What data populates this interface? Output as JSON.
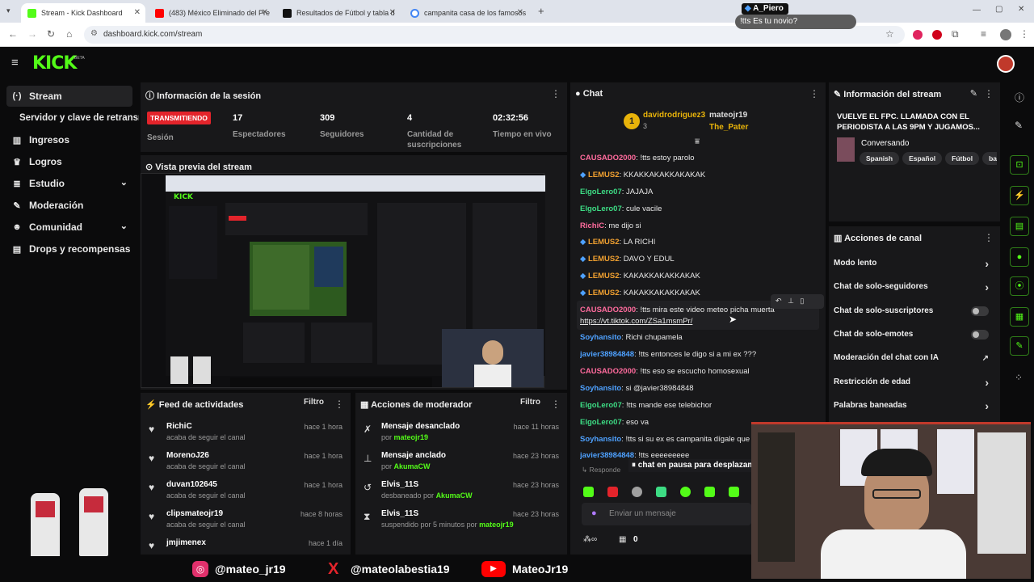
{
  "browser": {
    "tabs": [
      {
        "label": "Stream - Kick Dashboard",
        "color": "#53fc18"
      },
      {
        "label": "(483) México Eliminado del Pre",
        "color": "#ff0000"
      },
      {
        "label": "Resultados de Fútbol y tabla d",
        "color": "#111111"
      },
      {
        "label": "campanita casa de los famosos",
        "color": "#4285f4"
      }
    ],
    "url": "dashboard.kick.com/stream",
    "overlay_user": "A_Piero",
    "overlay_msg": "!tts Es tu novio?"
  },
  "app": {
    "logo": "KICK",
    "logo_badge": "BETA"
  },
  "sidebar": {
    "items": [
      {
        "label": "Stream",
        "icon": "radio-icon"
      },
      {
        "label": "Servidor y clave de retransm"
      },
      {
        "label": "Ingresos",
        "icon": "chart-icon"
      },
      {
        "label": "Logros",
        "icon": "trophy-icon"
      },
      {
        "label": "Estudio",
        "icon": "layers-icon"
      },
      {
        "label": "Moderación",
        "icon": "wrench-icon"
      },
      {
        "label": "Comunidad",
        "icon": "people-icon"
      },
      {
        "label": "Drops y recompensas",
        "icon": "gift-icon"
      }
    ]
  },
  "session": {
    "title": "Información de la sesión",
    "live_badge": "TRANSMITIENDO",
    "session_label": "Sesión",
    "viewers": "17",
    "viewers_label": "Espectadores",
    "followers": "309",
    "followers_label": "Seguidores",
    "subs": "4",
    "subs_label_1": "Cantidad de",
    "subs_label_2": "suscripciones",
    "uptime": "02:32:56",
    "uptime_label": "Tiempo en vivo"
  },
  "preview": {
    "title": "Vista previa del stream"
  },
  "feed": {
    "title": "Feed de actividades",
    "filter": "Filtro",
    "rows": [
      {
        "name": "RichiC",
        "sub": "acaba de seguir el canal",
        "time": "hace 1 hora"
      },
      {
        "name": "MorenoJ26",
        "sub": "acaba de seguir el canal",
        "time": "hace 1 hora"
      },
      {
        "name": "duvan102645",
        "sub": "acaba de seguir el canal",
        "time": "hace 1 hora"
      },
      {
        "name": "clipsmateojr19",
        "sub": "acaba de seguir el canal",
        "time": "hace 8 horas"
      },
      {
        "name": "jmjimenex",
        "sub": "",
        "time": "hace 1 día"
      }
    ]
  },
  "modactions": {
    "title": "Acciones de moderador",
    "filter": "Filtro",
    "rows": [
      {
        "name": "Mensaje desanclado",
        "pre": "por ",
        "who": "mateojr19",
        "time": "hace 11 horas"
      },
      {
        "name": "Mensaje anclado",
        "pre": "por ",
        "who": "AkumaCW",
        "time": "hace 23 horas"
      },
      {
        "name": "Elvis_11S",
        "pre": "desbaneado por ",
        "who": "AkumaCW",
        "time": "hace 23 horas"
      },
      {
        "name": "Elvis_11S",
        "pre": "suspendido por 5 minutos por ",
        "who": "mateojr19",
        "time": "hace 23 horas"
      }
    ]
  },
  "chat": {
    "title": "Chat",
    "top1": "davidrodriguez3",
    "top1_count": "3",
    "top2": "mateojr19",
    "top3": "The_Pater",
    "pause": "chat en pausa para desplazam",
    "reply": "Responde",
    "input_placeholder": "Enviar un mensaje",
    "points": "0",
    "messages": [
      {
        "user": "CAUSADO2000",
        "color": "#ff6b9d",
        "text": ": !tts estoy parolo"
      },
      {
        "user": "LEMUS2",
        "color": "#f0a030",
        "text": ": KKAKKAKAKKAKAKAK"
      },
      {
        "user": "ElgoLero07",
        "color": "#3ddc84",
        "text": ": JAJAJA"
      },
      {
        "user": "ElgoLero07",
        "color": "#3ddc84",
        "text": ": cule vacile"
      },
      {
        "user": "RichiC",
        "color": "#ff6b9d",
        "text": ": me dijo si"
      },
      {
        "user": "LEMUS2",
        "color": "#f0a030",
        "text": ": LA RICHI"
      },
      {
        "user": "LEMUS2",
        "color": "#f0a030",
        "text": ": DAVO Y EDUL"
      },
      {
        "user": "LEMUS2",
        "color": "#f0a030",
        "text": ": KAKAKKAKAKKAKAK"
      },
      {
        "user": "LEMUS2",
        "color": "#f0a030",
        "text": ": KAKAKKAKAKKAKAK"
      },
      {
        "user": "CAUSADO2000",
        "color": "#ff6b9d",
        "text": ": !tts mira este video meteo picha muerta"
      },
      {
        "user": "",
        "color": "#ffffff",
        "text": "https://vt.tiktok.com/ZSa1msmPr/"
      },
      {
        "user": "Soyhansito",
        "color": "#4ea1ff",
        "text": ": Richi chupamela"
      },
      {
        "user": "javier38984848",
        "color": "#4ea1ff",
        "text": ": !tts entonces le digo si a mi ex ???"
      },
      {
        "user": "CAUSADO2000",
        "color": "#ff6b9d",
        "text": ": !tts eso se escucho homosexual"
      },
      {
        "user": "Soyhansito",
        "color": "#4ea1ff",
        "text": ": si @javier38984848"
      },
      {
        "user": "ElgoLero07",
        "color": "#3ddc84",
        "text": ": !tts mande ese telebichor"
      },
      {
        "user": "ElgoLero07",
        "color": "#3ddc84",
        "text": ": eso va"
      },
      {
        "user": "Soyhansito",
        "color": "#4ea1ff",
        "text": ": !tts si su ex es campanita dígale que si"
      },
      {
        "user": "javier38984848",
        "color": "#4ea1ff",
        "text": ": !tts eeeeeeeee"
      }
    ]
  },
  "streaminfo": {
    "title": "Información del stream",
    "stream_title": "VUELVE EL FPC. LLAMADA CON EL PERIODISTA A LAS 9PM Y JUGAMOS...",
    "category": "Conversando",
    "tags": [
      "Spanish",
      "Español",
      "Fútbol",
      "barce"
    ]
  },
  "channel": {
    "title": "Acciones de canal",
    "options": [
      {
        "label": "Modo lento",
        "kind": "arrow"
      },
      {
        "label": "Chat de solo-seguidores",
        "kind": "arrow"
      },
      {
        "label": "Chat de solo-suscriptores",
        "kind": "toggle"
      },
      {
        "label": "Chat de solo-emotes",
        "kind": "toggle"
      },
      {
        "label": "Moderación del chat con IA",
        "kind": "external"
      },
      {
        "label": "Restricción de edad",
        "kind": "arrow"
      },
      {
        "label": "Palabras baneadas",
        "kind": "arrow"
      }
    ]
  },
  "socials": {
    "instagram": "@mateo_jr19",
    "x": "@mateolabestia19",
    "youtube": "MateoJr19"
  },
  "colors": {
    "brand": "#53fc18",
    "panel": "#18181b",
    "live": "#e3242b"
  }
}
